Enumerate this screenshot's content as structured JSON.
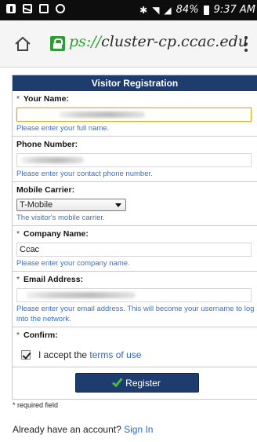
{
  "status_bar": {
    "battery_pct": "84%",
    "time": "9:37 AM",
    "icons": [
      "flipboard-icon",
      "mail-icon",
      "screen-icon",
      "clock-icon",
      "bluetooth-icon",
      "wifi-icon",
      "signal-icon",
      "battery-icon"
    ]
  },
  "browser": {
    "url_prefix": "ps://",
    "url_host": "cluster-cp.ccac.edu",
    "icons": [
      "home-icon",
      "lock-icon",
      "menu-icon"
    ]
  },
  "form": {
    "title": "Visitor Registration",
    "required_mark": "*",
    "your_name": {
      "label": "Your Name:",
      "value": "",
      "hint": "Please enter your full name."
    },
    "phone": {
      "label": "Phone Number:",
      "value": "",
      "hint": "Please enter your contact phone number."
    },
    "carrier": {
      "label": "Mobile Carrier:",
      "selected": "T-Mobile",
      "hint": "The visitor's mobile carrier."
    },
    "company": {
      "label": "Company Name:",
      "value": "Ccac",
      "hint": "Please enter your company name."
    },
    "email": {
      "label": "Email Address:",
      "value": "",
      "hint": "Please enter your email address. This will become your username to log into the network."
    },
    "confirm": {
      "label": "Confirm:",
      "accept_text": "I accept the",
      "terms_link": "terms of use",
      "checked": true
    },
    "register_label": "Register"
  },
  "footer": {
    "required_note": "required field",
    "account_text": "Already have an account?",
    "signin_link": "Sign In"
  },
  "colors": {
    "header_blue": "#1e3d6e",
    "hint_blue": "#3a6fc7",
    "secure_green": "#2e9d34",
    "focus_border": "#e0a820"
  }
}
